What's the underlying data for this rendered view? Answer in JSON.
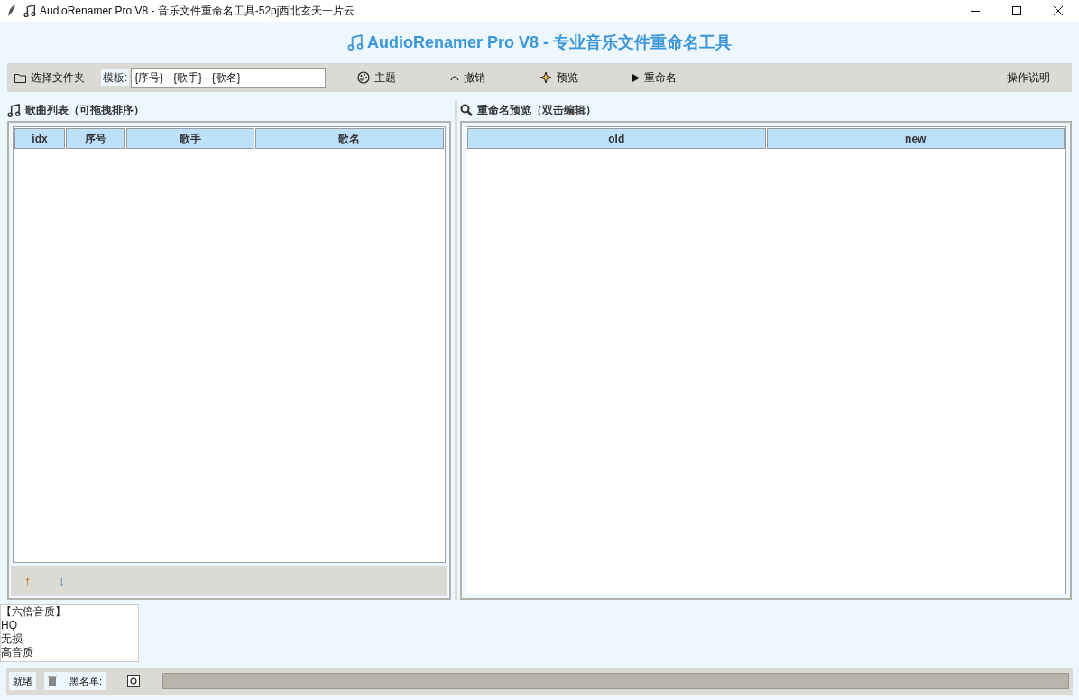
{
  "window": {
    "title": "AudioRenamer Pro V8 - 音乐文件重命名工具-52pj西北玄天一片云"
  },
  "header": {
    "title": "AudioRenamer Pro V8 - 专业音乐文件重命名工具"
  },
  "toolbar": {
    "choose_folder": "选择文件夹",
    "template_label": "模板:",
    "template_value": "{序号} - {歌手} - {歌名}",
    "buttons": [
      {
        "kind": "theme",
        "label": "主题"
      },
      {
        "kind": "undo",
        "label": "撤销"
      },
      {
        "kind": "preview",
        "label": "预览"
      },
      {
        "kind": "rename",
        "label": "重命名"
      }
    ],
    "help": "操作说明"
  },
  "song_list": {
    "title": "歌曲列表（可拖拽排序）",
    "columns": [
      "idx",
      "序号",
      "歌手",
      "歌名"
    ],
    "move_up": "↑",
    "move_down": "↓"
  },
  "preview": {
    "title": "重命名预览（双击编辑）",
    "columns": [
      "old",
      "new"
    ]
  },
  "quality_list": [
    "【六倍音质】",
    "HQ",
    "无损",
    "高音质"
  ],
  "status_bar": {
    "status": "就绪",
    "blacklist_label": "黑名单:",
    "progress": {
      "level": 0
    }
  }
}
